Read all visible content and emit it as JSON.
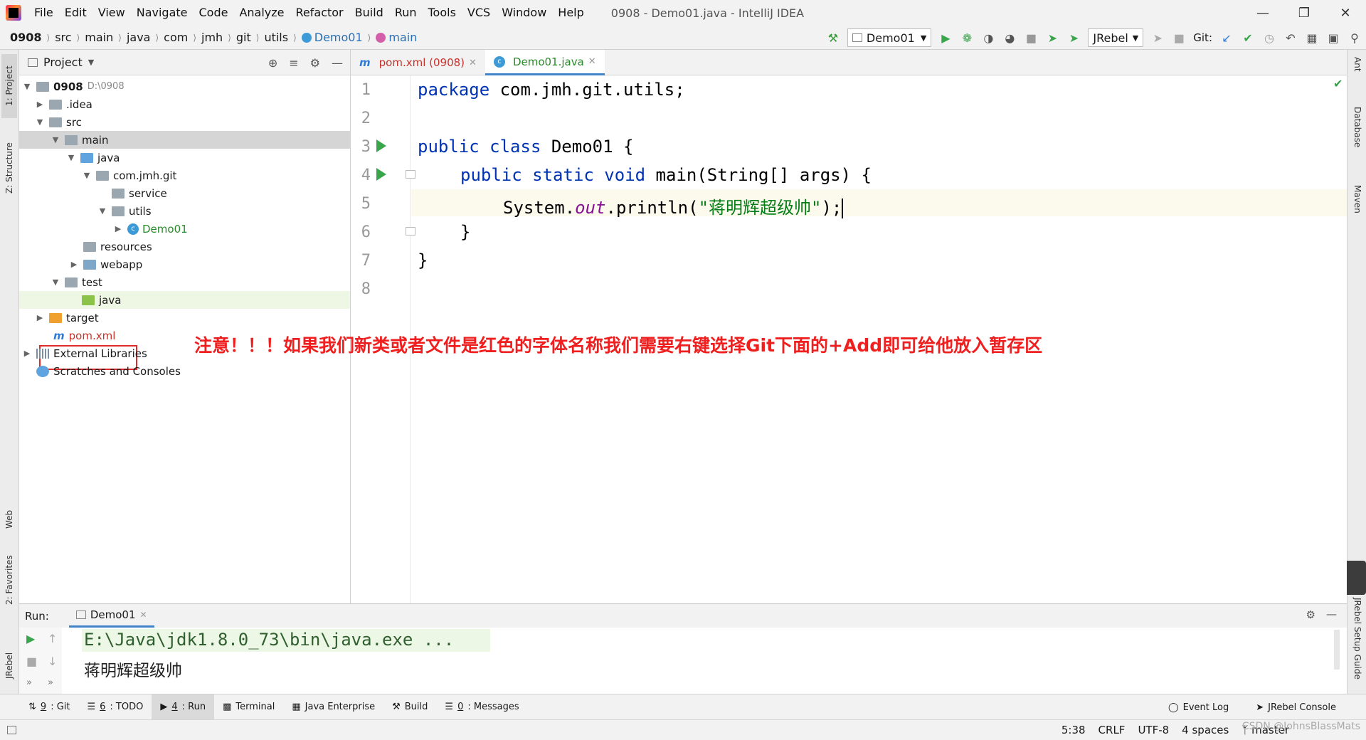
{
  "window": {
    "menu": [
      "File",
      "Edit",
      "View",
      "Navigate",
      "Code",
      "Analyze",
      "Refactor",
      "Build",
      "Run",
      "Tools",
      "VCS",
      "Window",
      "Help"
    ],
    "title": "0908 - Demo01.java - IntelliJ IDEA"
  },
  "breadcrumb": [
    "0908",
    "src",
    "main",
    "java",
    "com",
    "jmh",
    "git",
    "utils",
    "Demo01",
    "main"
  ],
  "toolbar": {
    "run_config": "Demo01",
    "jrebel": "JRebel",
    "git_label": "Git:"
  },
  "project_panel": {
    "title": "Project",
    "tree": [
      {
        "label": "0908",
        "path": "D:\\0908"
      },
      {
        "label": ".idea"
      },
      {
        "label": "src"
      },
      {
        "label": "main"
      },
      {
        "label": "java"
      },
      {
        "label": "com.jmh.git"
      },
      {
        "label": "service"
      },
      {
        "label": "utils"
      },
      {
        "label": "Demo01"
      },
      {
        "label": "resources"
      },
      {
        "label": "webapp"
      },
      {
        "label": "test"
      },
      {
        "label": "java"
      },
      {
        "label": "target"
      },
      {
        "label": "pom.xml"
      },
      {
        "label": "External Libraries"
      },
      {
        "label": "Scratches and Consoles"
      }
    ]
  },
  "editor": {
    "tabs": [
      {
        "label": "pom.xml (0908)"
      },
      {
        "label": "Demo01.java"
      }
    ],
    "line_numbers": [
      "1",
      "2",
      "3",
      "4",
      "5",
      "6",
      "7",
      "8"
    ],
    "code": {
      "l1_kw": "package",
      "l1_rest": " com.jmh.git.utils;",
      "l3_kw": "public class",
      "l3_rest": " Demo01 {",
      "l4_kw": "public static void",
      "l4_rest": " main(String[] args) {",
      "l5_a": "System.",
      "l5_field": "out",
      "l5_b": ".println(",
      "l5_str": "\"蒋明辉超级帅\"",
      "l5_c": ");",
      "l6": "}",
      "l7": "}"
    },
    "annotation": "注意！！！如果我们新类或者文件是红色的字体名称我们需要右键选择Git下面的+Add即可给他放入暂存区"
  },
  "run_panel": {
    "label": "Run:",
    "tab": "Demo01",
    "lines": [
      "E:\\Java\\jdk1.8.0_73\\bin\\java.exe ...",
      "蒋明辉超级帅"
    ]
  },
  "left_stripe": [
    "1: Project",
    "Z: Structure",
    "Web",
    "2: Favorites",
    "JRebel"
  ],
  "right_stripe": [
    "Ant",
    "Database",
    "Maven",
    "JRebel Setup Guide"
  ],
  "bottom_tools": [
    {
      "num": "9",
      "label": ": Git"
    },
    {
      "num": "6",
      "label": ": TODO"
    },
    {
      "num": "4",
      "label": ": Run"
    },
    {
      "num": "",
      "label": "Terminal"
    },
    {
      "num": "",
      "label": "Java Enterprise"
    },
    {
      "num": "",
      "label": "Build"
    },
    {
      "num": "0",
      "label": ": Messages"
    }
  ],
  "bottom_right_tools": [
    "Event Log",
    "JRebel Console"
  ],
  "status": {
    "position": "5:38",
    "line_sep": "CRLF",
    "encoding": "UTF-8",
    "indent": "4 spaces",
    "branch": "master"
  },
  "watermark": "CSDN @JohnsBlassMats"
}
